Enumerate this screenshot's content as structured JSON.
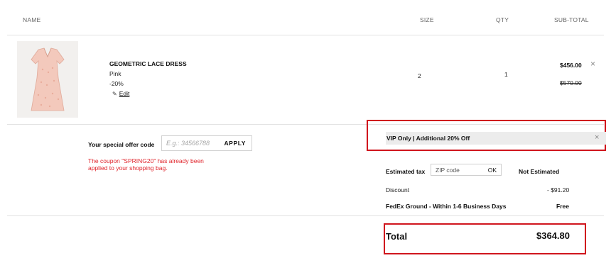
{
  "table_header": {
    "name": "NAME",
    "size": "SIZE",
    "qty": "QTY",
    "subtotal": "SUB-TOTAL"
  },
  "item": {
    "name": "GEOMETRIC LACE DRESS",
    "color": "Pink",
    "discount": "-20%",
    "edit_label": "Edit",
    "size": "2",
    "qty": "1",
    "price": "$456.00",
    "original_price": "$570.00",
    "remove_icon": "×",
    "image_icon": "dress-image"
  },
  "offer": {
    "label": "Your special offer code",
    "placeholder": "E.g.: 34566788",
    "apply_label": "APPLY",
    "message": "The coupon \"SPRING20\" has already been applied to your shopping bag."
  },
  "vip": {
    "label": "VIP Only | Additional 20% Off",
    "close_icon": "×"
  },
  "summary": {
    "tax_label": "Estimated tax",
    "zip_placeholder": "ZIP code",
    "ok_label": "OK",
    "tax_value": "Not Estimated",
    "discount_label": "Discount",
    "discount_value": "- $91.20",
    "shipping_label": "FedEx Ground - Within 1-6 Business Days",
    "shipping_value": "Free",
    "total_label": "Total",
    "total_value": "$364.80"
  },
  "colors": {
    "highlight_border": "#d0151d",
    "coupon_message": "#e0242b",
    "vip_bar_bg": "#ececec"
  }
}
